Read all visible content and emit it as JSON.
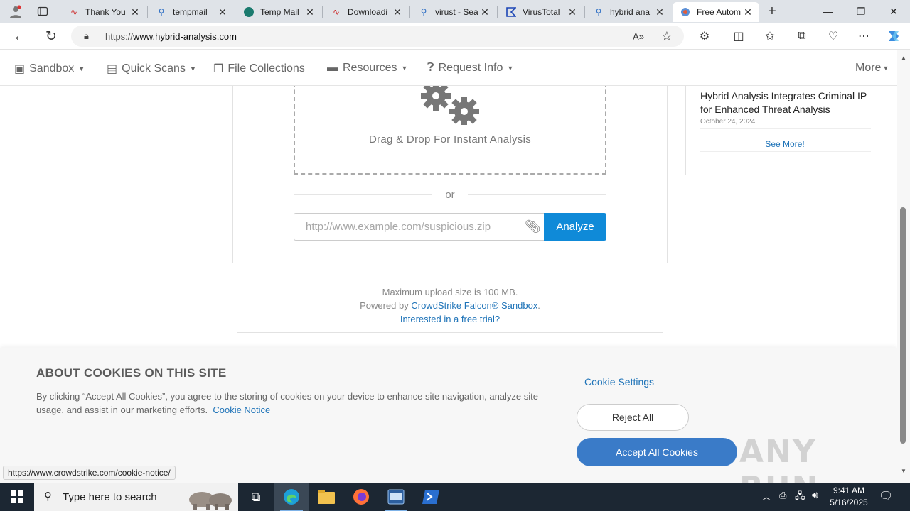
{
  "browser": {
    "tabs": [
      {
        "title": "Thank You",
        "icon": "red-swoosh-icon"
      },
      {
        "title": "tempmail",
        "icon": "search-icon"
      },
      {
        "title": "Temp Mail",
        "icon": "tempmail-icon"
      },
      {
        "title": "Downloadi",
        "icon": "red-swoosh-icon"
      },
      {
        "title": "virust - Sea",
        "icon": "search-icon"
      },
      {
        "title": "VirusTotal",
        "icon": "virustotal-icon"
      },
      {
        "title": "hybrid ana",
        "icon": "search-icon"
      },
      {
        "title": "Free Autom",
        "icon": "hybrid-analysis-icon"
      }
    ],
    "url_prefix": "https://",
    "url_host": "www.hybrid-analysis.com"
  },
  "nav": {
    "sandbox": "Sandbox",
    "quick_scans": "Quick Scans",
    "file_collections": "File Collections",
    "resources": "Resources",
    "request_info": "Request Info",
    "more": "More"
  },
  "upload": {
    "drop_text": "Drag & Drop For Instant Analysis",
    "or": "or",
    "url_placeholder": "http://www.example.com/suspicious.zip",
    "analyze": "Analyze"
  },
  "info": {
    "max_upload": "Maximum upload size is 100 MB.",
    "powered_by": "Powered by",
    "powered_link": "CrowdStrike Falcon® Sandbox",
    "powered_end": ".",
    "trial": "Interested in a free trial?"
  },
  "news": {
    "title": "Hybrid Analysis Integrates Criminal IP for Enhanced Threat Analysis",
    "date": "October 24, 2024",
    "see_more": "See More!"
  },
  "cookie": {
    "title": "ABOUT COOKIES ON THIS SITE",
    "text": "By clicking “Accept All Cookies”, you agree to the storing of cookies on your device to enhance site navigation, analyze site usage, and assist in our marketing efforts.",
    "notice_link": "Cookie Notice",
    "settings": "Cookie Settings",
    "reject": "Reject All",
    "accept": "Accept All Cookies"
  },
  "watermark": "ANY RUN",
  "status_url": "https://www.crowdstrike.com/cookie-notice/",
  "taskbar": {
    "search_placeholder": "Type here to search",
    "time": "9:41 AM",
    "date": "5/16/2025"
  },
  "colors": {
    "accent": "#0f8ad8",
    "accept_button": "#3a7bc8",
    "link": "#1e73b8",
    "taskbar": "#1c2733"
  }
}
